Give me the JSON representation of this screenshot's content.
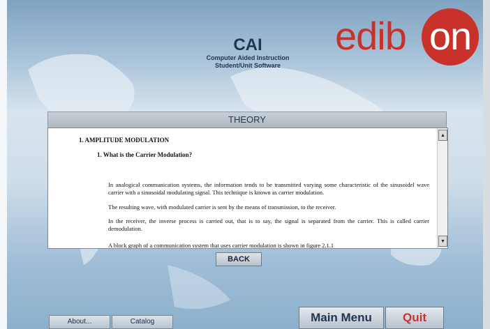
{
  "header": {
    "title": "CAI",
    "subtitle_line1": "Computer Aided Instruction",
    "subtitle_line2": "Student/Unit Software"
  },
  "logo": {
    "text_left": "edib",
    "text_right": "on",
    "brand_color": "#c9312b"
  },
  "section": {
    "title": "THEORY"
  },
  "document": {
    "heading1": "1.   AMPLITUDE MODULATION",
    "heading2": "1.   What is the Carrier Modulation?",
    "paragraphs": [
      "In analogical communication systems, the information tends to be transmitted varying some characteristic of the sinusoidel wave carrier with a sinusoidal modulating signal. This technique is known as carrier modulation.",
      "The resulting wave, with modulated carrier is sent by the means of transmission, to the receiver.",
      "In the receiver, the inverse process is carried out, that is to say, the signal is separated from the carrier. This is called carrier demodulation.",
      "A block graph of a communication system that uses carrier modulation is shown in figure 2.1.1"
    ]
  },
  "buttons": {
    "back": "BACK",
    "about": "About...",
    "catalog": "Catalog",
    "main_menu": "Main Menu",
    "quit": "Quit"
  },
  "colors": {
    "title_blue": "#1f3550",
    "accent_red": "#c9312b"
  }
}
